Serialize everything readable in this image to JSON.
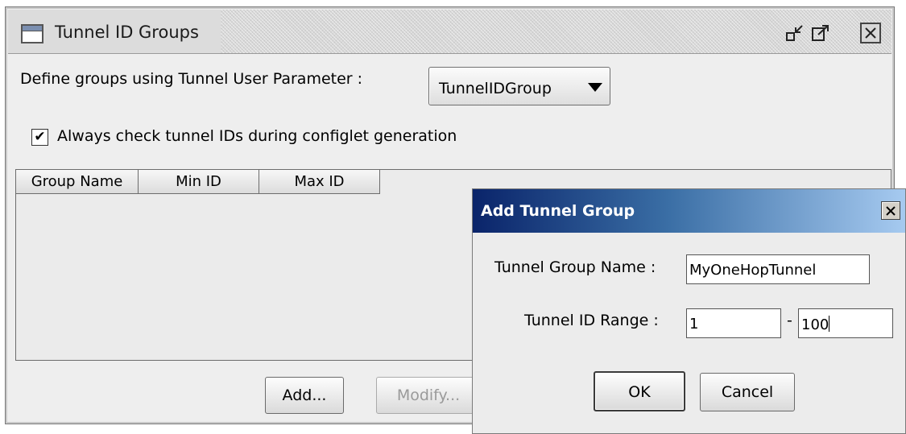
{
  "main_window": {
    "title": "Tunnel ID Groups",
    "define_label": "Define groups using Tunnel User Parameter :",
    "parameter_dropdown": {
      "selected": "TunnelIDGroup"
    },
    "always_check": {
      "checked": true,
      "label": "Always check tunnel IDs during configlet generation"
    },
    "table": {
      "columns": [
        "Group Name",
        "Min ID",
        "Max ID"
      ],
      "rows": []
    },
    "buttons": {
      "add": "Add...",
      "modify": "Modify..."
    }
  },
  "dialog": {
    "title": "Add Tunnel Group",
    "group_name_label": "Tunnel Group Name :",
    "group_name_value": "MyOneHopTunnel",
    "range_label": "Tunnel ID Range :",
    "range_min": "1",
    "range_separator": "-",
    "range_max": "100",
    "ok_label": "OK",
    "cancel_label": "Cancel"
  },
  "colors": {
    "dialog_titlebar_start": "#0a246a",
    "dialog_titlebar_end": "#a6caf0",
    "panel_background": "#eeeeee"
  },
  "icons": [
    "window-icon",
    "minimize-icon",
    "maximize-icon",
    "close-icon",
    "dropdown-arrow-icon",
    "checkmark-icon"
  ]
}
